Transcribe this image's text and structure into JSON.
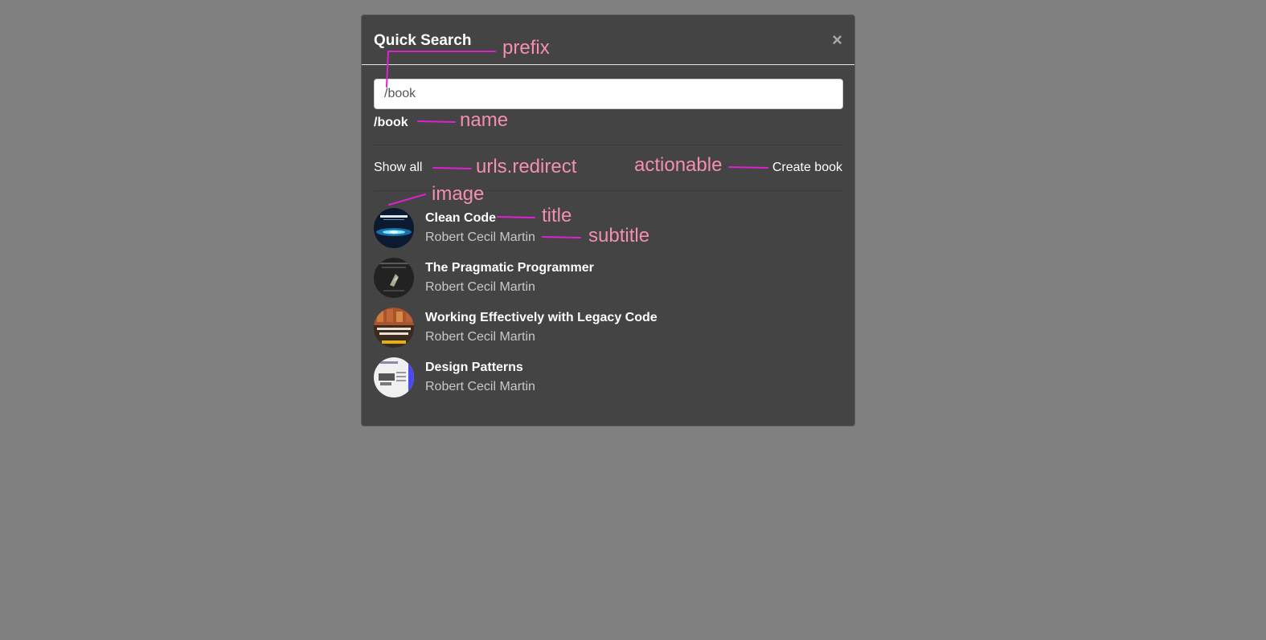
{
  "modal": {
    "title": "Quick Search",
    "close_symbol": "×",
    "close_icon": "close-icon"
  },
  "search": {
    "value": "/book",
    "placeholder": ""
  },
  "group": {
    "name": "/book"
  },
  "actions": {
    "show_all": "Show all",
    "create": "Create book"
  },
  "results": [
    {
      "title": "Clean Code",
      "subtitle": "Robert Cecil Martin",
      "thumb_icon": "clean-code-cover"
    },
    {
      "title": "The Pragmatic Programmer",
      "subtitle": "Robert Cecil Martin",
      "thumb_icon": "pragmatic-programmer-cover"
    },
    {
      "title": "Working Effectively with Legacy Code",
      "subtitle": "Robert Cecil Martin",
      "thumb_icon": "legacy-code-cover"
    },
    {
      "title": "Design Patterns",
      "subtitle": "Robert Cecil Martin",
      "thumb_icon": "design-patterns-cover"
    }
  ],
  "annotations": {
    "prefix": "prefix",
    "name": "name",
    "redirect": "urls.redirect",
    "actionable": "actionable",
    "image": "image",
    "title": "title",
    "subtitle": "subtitle"
  },
  "colors": {
    "page_bg": "#808080",
    "modal_bg": "#444444",
    "annotation_text": "#f48fb1",
    "annotation_line": "#e020d0"
  }
}
